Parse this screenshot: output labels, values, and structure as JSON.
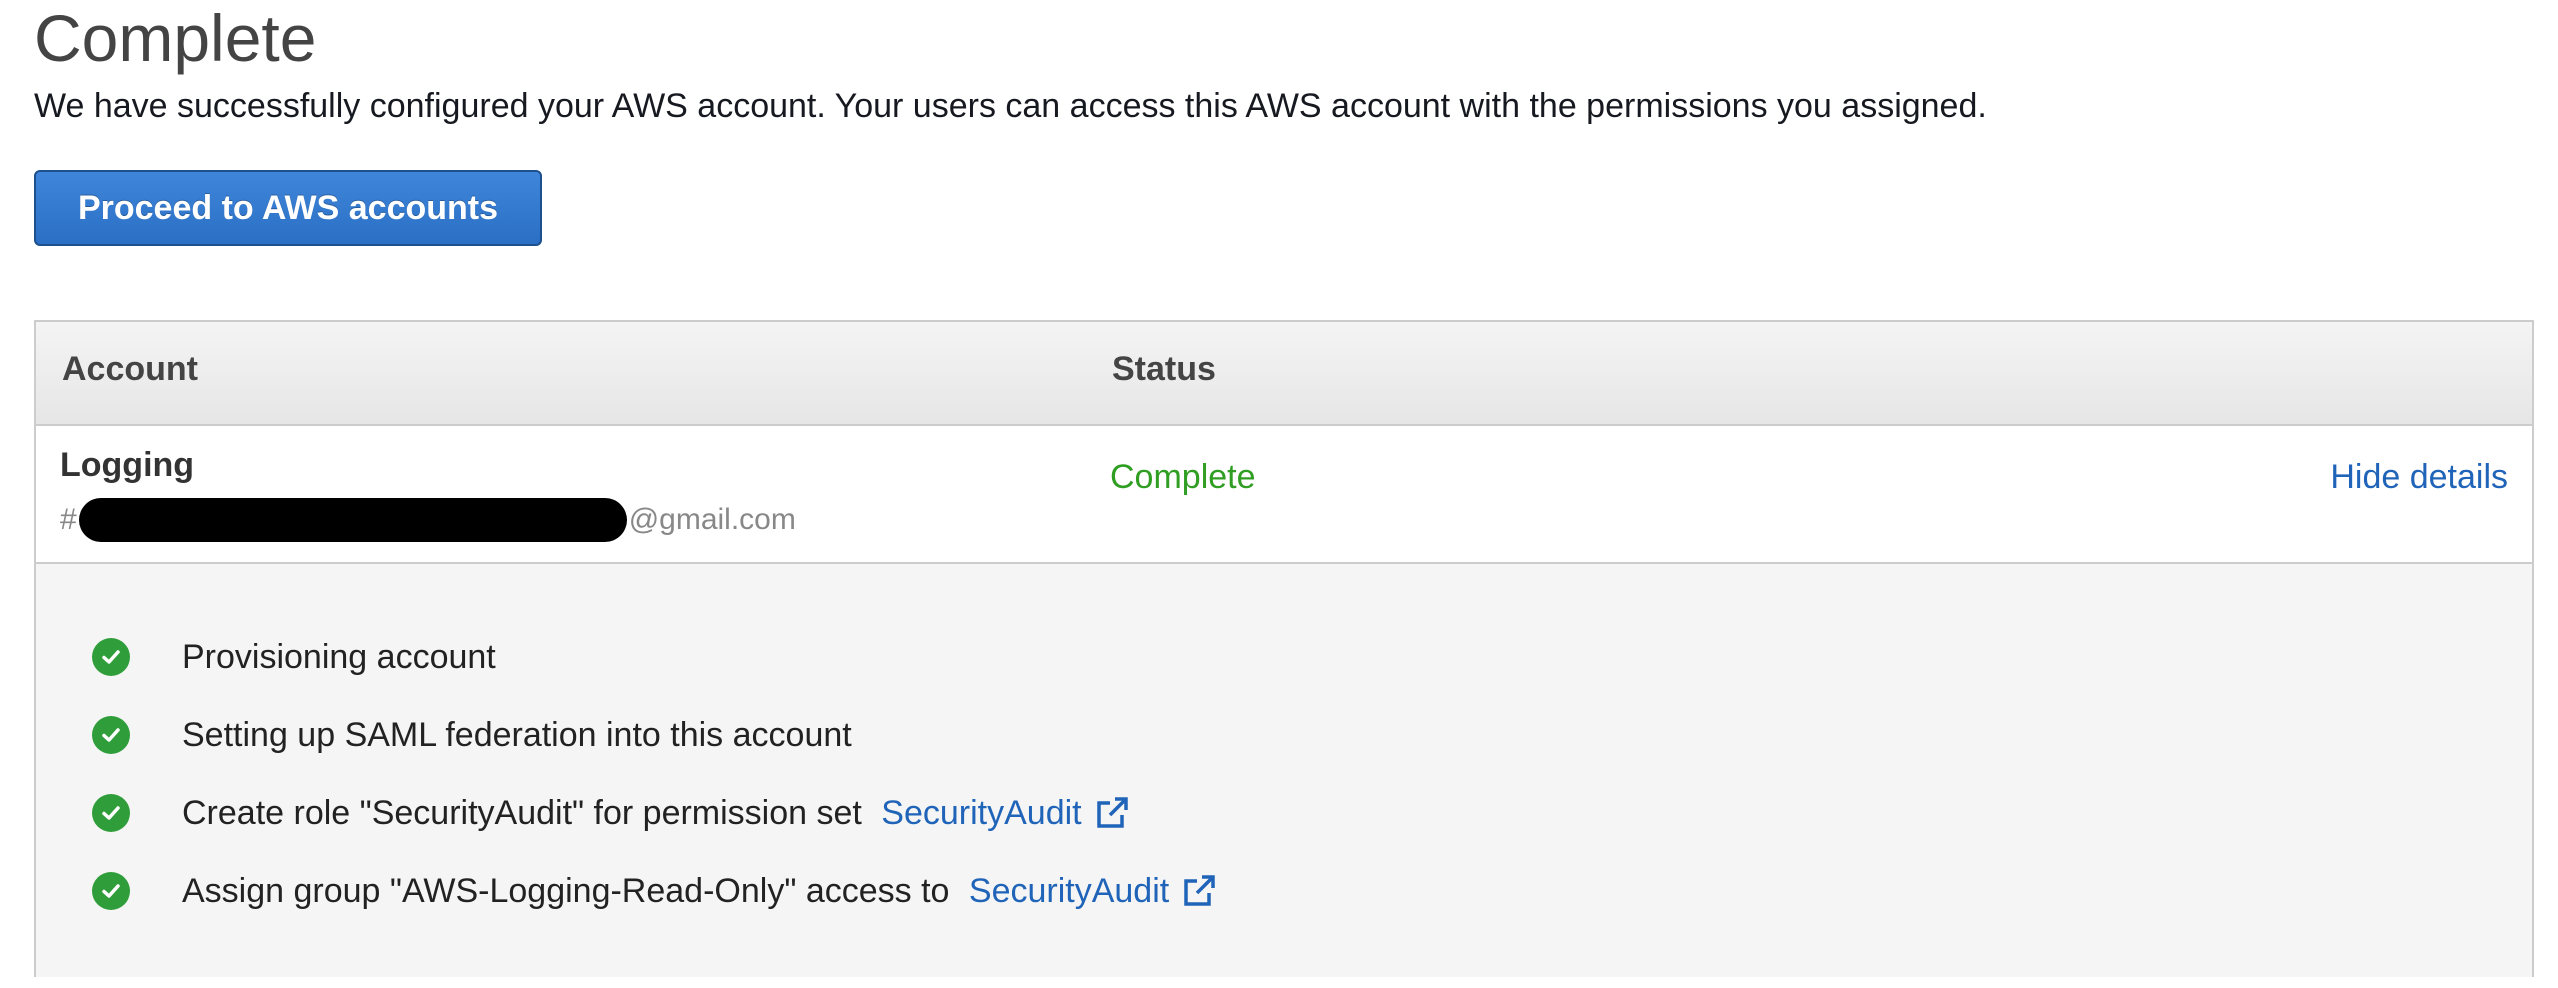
{
  "page": {
    "title": "Complete",
    "subtitle": "We have successfully configured your AWS account. Your users can access this AWS account with the permissions you assigned.",
    "proceed_button_label": "Proceed to AWS accounts"
  },
  "table": {
    "headers": {
      "account": "Account",
      "status": "Status"
    },
    "row": {
      "account_name": "Logging",
      "email_prefix": "#",
      "email_suffix": "@gmail.com",
      "status": "Complete",
      "hide_details_label": "Hide details"
    },
    "steps": [
      {
        "text": "Provisioning account"
      },
      {
        "text": "Setting up SAML federation into this account"
      },
      {
        "text": "Create role \"SecurityAudit\" for permission set ",
        "link": "SecurityAudit"
      },
      {
        "text": "Assign group \"AWS-Logging-Read-Only\" access to ",
        "link": "SecurityAudit"
      }
    ]
  },
  "colors": {
    "primary_button": "#2a6fc4",
    "status_complete": "#2f9e22",
    "link": "#1f64b8",
    "check_icon": "#2f9e3a"
  },
  "icons": {
    "step_status": "check-circle-icon",
    "external_link": "external-link-icon"
  }
}
